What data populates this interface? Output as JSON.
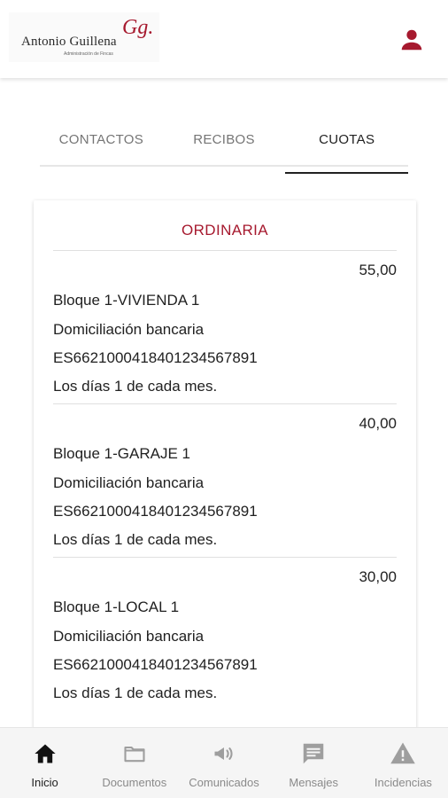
{
  "header": {
    "logo_name": "Antonio Guillena",
    "logo_subtitle": "Administración de Fincas",
    "logo_mark": "Gg."
  },
  "tabs": [
    {
      "label": "CONTACTOS",
      "active": false
    },
    {
      "label": "RECIBOS",
      "active": false
    },
    {
      "label": "CUOTAS",
      "active": true
    }
  ],
  "card": {
    "title": "ORDINARIA",
    "entries": [
      {
        "amount": "55,00",
        "unit": "Bloque 1-VIVIENDA 1",
        "payment": "Domiciliación bancaria",
        "iban": "ES6621000418401234567891",
        "schedule": "Los días 1 de cada mes."
      },
      {
        "amount": "40,00",
        "unit": "Bloque 1-GARAJE 1",
        "payment": "Domiciliación bancaria",
        "iban": "ES6621000418401234567891",
        "schedule": "Los días 1 de cada mes."
      },
      {
        "amount": "30,00",
        "unit": "Bloque 1-LOCAL 1",
        "payment": "Domiciliación bancaria",
        "iban": "ES6621000418401234567891",
        "schedule": "Los días 1 de cada mes."
      }
    ]
  },
  "bottom_nav": [
    {
      "label": "Inicio",
      "icon": "home-icon",
      "active": true
    },
    {
      "label": "Documentos",
      "icon": "folder-icon",
      "active": false
    },
    {
      "label": "Comunicados",
      "icon": "megaphone-icon",
      "active": false
    },
    {
      "label": "Mensajes",
      "icon": "chat-icon",
      "active": false
    },
    {
      "label": "Incidencias",
      "icon": "warning-icon",
      "active": false
    }
  ],
  "colors": {
    "brand": "#a6192e",
    "text": "#212121",
    "muted": "#8a8a8a"
  }
}
